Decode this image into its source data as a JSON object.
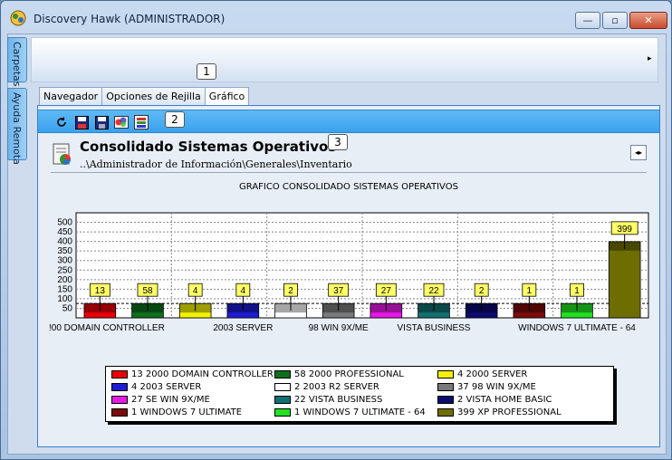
{
  "window": {
    "title": "Discovery Hawk (ADMINISTRADOR)",
    "minimize": "—",
    "maximize": "▫",
    "close": "✕"
  },
  "sidebar": {
    "tabs": [
      {
        "label": "Carpetas"
      },
      {
        "label": "Ayuda Remota"
      }
    ]
  },
  "ribbon": {
    "expand_arrow": "▸"
  },
  "callouts": [
    "1",
    "2",
    "3"
  ],
  "tabs": [
    {
      "label": "Navegador"
    },
    {
      "label": "Opciones de Rejilla"
    },
    {
      "label": "Gráfico"
    }
  ],
  "toolbar": {
    "icons": [
      "refresh-icon",
      "save-icon",
      "save-as-icon",
      "color-icon",
      "export-icon"
    ]
  },
  "header": {
    "title": "Consolidado Sistemas Operativos",
    "path": "..\\Administrador de Información\\Generales\\Inventario",
    "nav_arrows": "◂▸"
  },
  "chart_data": {
    "type": "bar",
    "title": "GRAFICO CONSOLIDADO SISTEMAS OPERATIVOS",
    "ylim": [
      0,
      550
    ],
    "yticks": [
      50,
      100,
      150,
      200,
      250,
      300,
      350,
      400,
      450,
      500
    ],
    "grid": true,
    "legend_position": "bottom",
    "categories": [
      "2000 DOMAIN CONTROLLER",
      "2000 PROFESSIONAL",
      "2000 SERVER",
      "2003 SERVER",
      "2003 R2 SERVER",
      "98 WIN 9X/ME",
      "SE  WIN 9X/ME",
      "VISTA BUSINESS",
      "VISTA HOME BASIC",
      "WINDOWS 7 ULTIMATE",
      "WINDOWS 7 ULTIMATE - 64",
      "XP PROFESSIONAL"
    ],
    "values": [
      13,
      58,
      4,
      4,
      2,
      37,
      27,
      22,
      2,
      1,
      1,
      399
    ],
    "colors": [
      "#e8000b",
      "#0e6f1e",
      "#f2f200",
      "#1d1dd2",
      "#ffffff",
      "#7a7a7a",
      "#e619e6",
      "#127070",
      "#0c0c6e",
      "#7a0c0c",
      "#22e022",
      "#6e6e00"
    ],
    "visible_x_labels": [
      {
        "index": 0,
        "text": "!00 DOMAIN CONTROLLER"
      },
      {
        "index": 3,
        "text": "2003 SERVER"
      },
      {
        "index": 5,
        "text": "98 WIN 9X/ME"
      },
      {
        "index": 7,
        "text": "VISTA BUSINESS"
      },
      {
        "index": 10,
        "text": "WINDOWS 7 ULTIMATE - 64"
      }
    ],
    "legend": [
      "13 2000 DOMAIN CONTROLLER",
      "58 2000 PROFESSIONAL",
      "4 2000 SERVER",
      "4 2003 SERVER",
      "2 2003 R2 SERVER",
      "37 98 WIN 9X/ME",
      "27 SE  WIN 9X/ME",
      "22 VISTA BUSINESS",
      "2 VISTA HOME BASIC",
      "1 WINDOWS 7 ULTIMATE",
      "1 WINDOWS 7 ULTIMATE - 64",
      "399 XP PROFESSIONAL"
    ]
  }
}
